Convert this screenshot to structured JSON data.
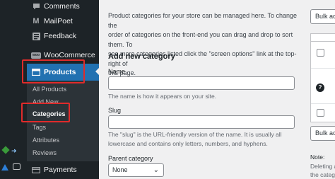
{
  "sidebar": {
    "comments": "Comments",
    "mailpoet": "MailPoet",
    "feedback": "Feedback",
    "woocommerce": "WooCommerce",
    "woo_icon_text": "woo",
    "products": "Products",
    "sub": {
      "all_products": "All Products",
      "add_new": "Add New",
      "categories": "Categories",
      "tags": "Tags",
      "attributes": "Attributes",
      "reviews": "Reviews"
    },
    "payments": "Payments"
  },
  "main": {
    "intro_line1": "Product categories for your store can be managed here. To change the",
    "intro_line2": "order of categories on the front-end you can drag and drop to sort them. To",
    "intro_line3": "see more categories listed click the \"screen options\" link at the top-right of",
    "intro_line4": "this page.",
    "add_heading": "Add new category",
    "name_label": "Name",
    "name_value": "",
    "name_help": "The name is how it appears on your site.",
    "slug_label": "Slug",
    "slug_value": "",
    "slug_help_line1": "The \"slug\" is the URL-friendly version of the name. It is usually all",
    "slug_help_line2": "lowercase and contains only letters, numbers, and hyphens.",
    "parent_label": "Parent category",
    "parent_value": "None"
  },
  "right": {
    "bulk_top": "Bulk ac",
    "bulk_bottom": "Bulk ac",
    "qmark": "?",
    "note_label": "Note:",
    "note_line1": "Deleting a",
    "note_line2": "the catego"
  },
  "colors": {
    "sidebar_bg": "#1d2327",
    "active_blue": "#2271b1",
    "highlight_red": "#e02b2b",
    "content_bg": "#f0f0f1"
  },
  "icons": {
    "comments": "comment-bubble-icon",
    "mailpoet": "mailpoet-m-icon",
    "feedback": "feedback-grid-icon",
    "woocommerce": "woo-logo-icon",
    "products": "archive-box-icon",
    "payments": "credit-card-icon",
    "parent_select": "chevron-down-icon"
  }
}
